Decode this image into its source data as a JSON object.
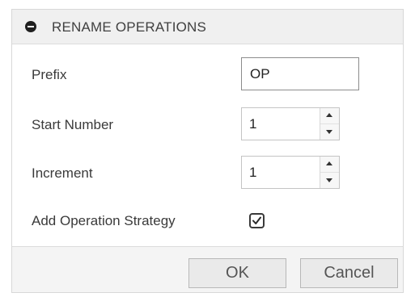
{
  "header": {
    "title": "RENAME OPERATIONS",
    "collapse_icon": "minus-circle-icon"
  },
  "fields": {
    "prefix": {
      "label": "Prefix",
      "value": "OP"
    },
    "start_number": {
      "label": "Start Number",
      "value": "1"
    },
    "increment": {
      "label": "Increment",
      "value": "1"
    },
    "add_operation_strategy": {
      "label": "Add Operation Strategy",
      "checked": true
    }
  },
  "footer": {
    "ok_label": "OK",
    "cancel_label": "Cancel"
  }
}
